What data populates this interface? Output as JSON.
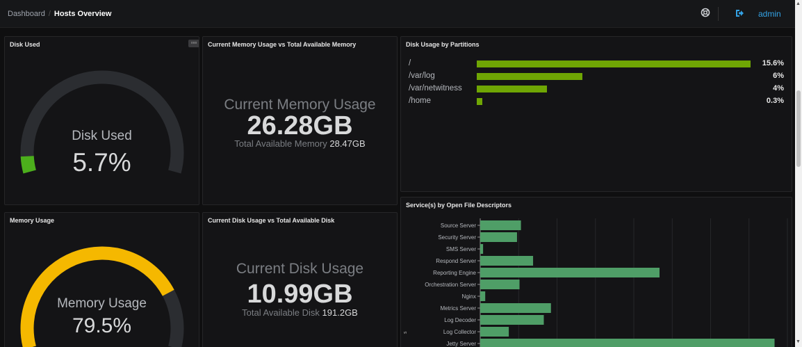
{
  "breadcrumb": {
    "parent": "Dashboard",
    "separator": "/",
    "current": "Hosts Overview"
  },
  "topbar": {
    "user": "admin",
    "help_icon": "globe-help-icon",
    "signout_icon": "sign-out-icon",
    "accent": "#33a2e5"
  },
  "panels": {
    "disk_used": {
      "title": "Disk Used",
      "label": "Disk Used",
      "value": "5.7%",
      "fraction": 0.057,
      "color": "#4caf1c"
    },
    "memory_usage": {
      "title": "Memory Usage",
      "label": "Memory Usage",
      "value": "79.5%",
      "fraction": 0.795,
      "color": "#f5b800"
    },
    "current_memory": {
      "title": "Current Memory Usage vs Total Available Memory",
      "stat_title": "Current Memory Usage",
      "value": "26.28GB",
      "sub_label": "Total Available Memory",
      "sub_value": "28.47GB"
    },
    "current_disk": {
      "title": "Current Disk Usage vs Total Available Disk",
      "stat_title": "Current Disk Usage",
      "value": "10.99GB",
      "sub_label": "Total Available Disk",
      "sub_value": "191.2GB"
    },
    "disk_partitions": {
      "title": "Disk Usage by Partitions",
      "items": [
        {
          "name": "/",
          "pct": "15.6%",
          "value": 15.6
        },
        {
          "name": "/var/log",
          "pct": "6%",
          "value": 6
        },
        {
          "name": "/var/netwitness",
          "pct": "4%",
          "value": 4
        },
        {
          "name": "/home",
          "pct": "0.3%",
          "value": 0.3
        }
      ],
      "bar_color": "#6fa604"
    },
    "open_fd": {
      "title": "Service(s) by Open File Descriptors",
      "axis_letter": "s"
    }
  },
  "chart_data": {
    "type": "bar",
    "orientation": "horizontal",
    "title": "Service(s) by Open File Descriptors",
    "categories": [
      "Source Server",
      "Security Server",
      "SMS Server",
      "Respond Server",
      "Reporting Engine",
      "Orchestration Server",
      "Nginx",
      "Metrics Server",
      "Log Decoder",
      "Log Collector",
      "Jetty Server"
    ],
    "values": [
      114,
      103,
      8,
      148,
      502,
      110,
      14,
      198,
      178,
      80,
      824
    ],
    "xlim": [
      0,
      860
    ],
    "grid": true,
    "bar_color": "#4f9e67"
  },
  "scrollbar": {
    "up_icon": "scroll-up-arrow-icon",
    "down_icon": "scroll-down-arrow-icon"
  }
}
